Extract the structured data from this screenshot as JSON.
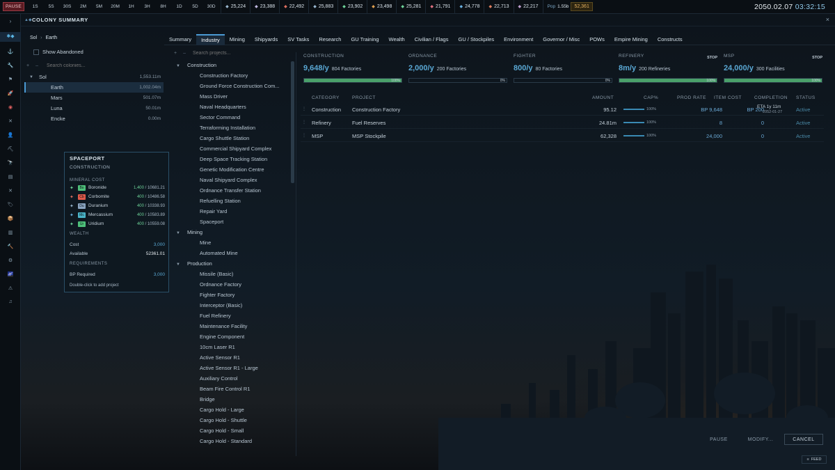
{
  "topbar": {
    "pause_label": "PAUSE",
    "speeds": [
      "1S",
      "5S",
      "30S",
      "2M",
      "5M",
      "20M",
      "1H",
      "3H",
      "8H",
      "1D",
      "5D",
      "30D"
    ],
    "resources": [
      {
        "icon": "duranium-icon",
        "color": "#9ab8d0",
        "value": "25,224"
      },
      {
        "icon": "neutronium-icon",
        "color": "#c0b8e0",
        "value": "23,388"
      },
      {
        "icon": "corbomite-icon",
        "color": "#e07060",
        "value": "22,492"
      },
      {
        "icon": "tritanium-icon",
        "color": "#9ab8d0",
        "value": "25,883"
      },
      {
        "icon": "boronide-icon",
        "color": "#6ed49a",
        "value": "23,902"
      },
      {
        "icon": "mercassium-icon",
        "color": "#e0a050",
        "value": "23,498"
      },
      {
        "icon": "vendarite-icon",
        "color": "#6ed49a",
        "value": "25,281"
      },
      {
        "icon": "sorium-icon",
        "color": "#e07080",
        "value": "21,791"
      },
      {
        "icon": "uridium-icon",
        "color": "#6ab0e0",
        "value": "24,778"
      },
      {
        "icon": "corundium-icon",
        "color": "#e08060",
        "value": "22,713"
      },
      {
        "icon": "gallicite-icon",
        "color": "#c0a0d0",
        "value": "22,217"
      }
    ],
    "pop_label": "Pop",
    "pop_value": "1.55b",
    "wealth": "52,361",
    "date": "2050.02.07",
    "time": "03:32:15"
  },
  "window": {
    "title": "COLONY SUMMARY"
  },
  "breadcrumb": {
    "system": "Sol",
    "colony": "Earth"
  },
  "colonies_panel": {
    "show_abandoned": "Show Abandoned",
    "search_placeholder": "Search colonies...",
    "rows": [
      {
        "name": "Sol",
        "value": "1,553.11m"
      },
      {
        "name": "Earth",
        "value": "1,002.04m"
      },
      {
        "name": "Mars",
        "value": "501.07m"
      },
      {
        "name": "Luna",
        "value": "50.01m"
      },
      {
        "name": "Encke",
        "value": "0.00m"
      }
    ]
  },
  "tooltip": {
    "title": "SPACEPORT",
    "subtitle": "CONSTRUCTION",
    "mineral_header": "MINERAL COST",
    "minerals": [
      {
        "abbr": "Bo",
        "name": "Boronide",
        "need": "1,400",
        "have": "10681.21",
        "color": "#4ec07a",
        "icon": "boronide-icon",
        "ic": "#6ed49a"
      },
      {
        "abbr": "Cb",
        "name": "Corbomite",
        "need": "400",
        "have": "10486.58",
        "color": "#e05a4a",
        "icon": "corbomite-icon",
        "ic": "#e07060"
      },
      {
        "abbr": "Du",
        "name": "Duranium",
        "need": "400",
        "have": "10338.93",
        "color": "#8aa4c0",
        "icon": "duranium-icon",
        "ic": "#9ab8d0"
      },
      {
        "abbr": "Mc",
        "name": "Mercassium",
        "need": "400",
        "have": "10583.89",
        "color": "#4ab4c8",
        "icon": "mercassium-icon",
        "ic": "#6ab0e0"
      },
      {
        "abbr": "Ur",
        "name": "Uridium",
        "need": "400",
        "have": "10559.08",
        "color": "#4ec07a",
        "icon": "uridium-icon",
        "ic": "#6ed49a"
      }
    ],
    "wealth_header": "WEALTH",
    "cost_label": "Cost",
    "cost_value": "3,000",
    "available_label": "Available",
    "available_value": "52361.01",
    "req_header": "REQUIREMENTS",
    "bp_label": "BP Required",
    "bp_value": "3,000",
    "hint": "Double-click to add project"
  },
  "tabs": [
    "Summary",
    "Industry",
    "Mining",
    "Shipyards",
    "SV Tasks",
    "Research",
    "GU Training",
    "Wealth",
    "Civilian / Flags",
    "GU / Stockpiles",
    "Environment",
    "Governor / Misc",
    "POWs",
    "Empire Mining",
    "Constructs"
  ],
  "active_tab": "Industry",
  "projects": {
    "search_placeholder": "Search projects...",
    "categories": [
      {
        "name": "Construction",
        "items": [
          "Construction Factory",
          "Ground Force Construction Com...",
          "Mass Driver",
          "Naval Headquarters",
          "Sector Command",
          "Terraforming Installation",
          "Cargo Shuttle Station",
          "Commercial Shipyard Complex",
          "Deep Space Tracking Station",
          "Genetic Modification Centre",
          "Naval Shipyard Complex",
          "Ordnance Transfer Station",
          "Refuelling Station",
          "Repair Yard",
          "Spaceport"
        ]
      },
      {
        "name": "Mining",
        "items": [
          "Mine",
          "Automated Mine"
        ]
      },
      {
        "name": "Production",
        "items": [
          "Missile (Basic)",
          "Ordnance Factory",
          "Fighter Factory",
          "Interceptor (Basic)",
          "Fuel Refinery",
          "Maintenance Facility",
          "Engine Component",
          "10cm Laser R1",
          "Active Sensor R1",
          "Active Sensor R1 - Large",
          "Auxiliary Control",
          "Beam Fire Control R1",
          "Bridge",
          "Cargo Hold - Large",
          "Cargo Hold - Shuttle",
          "Cargo Hold - Small",
          "Cargo Hold - Standard"
        ]
      }
    ]
  },
  "summary": [
    {
      "label": "CONSTRUCTION",
      "value": "9,648/y",
      "sub": "804 Factories",
      "fill": 1.0,
      "bar": "100%",
      "stop": ""
    },
    {
      "label": "ORDNANCE",
      "value": "2,000/y",
      "sub": "200 Factories",
      "fill": 0,
      "bar": "0%",
      "stop": ""
    },
    {
      "label": "FIGHTER",
      "value": "800/y",
      "sub": "80 Factories",
      "fill": 0,
      "bar": "0%",
      "stop": ""
    },
    {
      "label": "REFINERY",
      "value": "8m/y",
      "sub": "200 Refineries",
      "fill": 1.0,
      "bar": "100%",
      "stop": "STOP"
    },
    {
      "label": "MSP",
      "value": "24,000/y",
      "sub": "300 Facilities",
      "fill": 1.0,
      "bar": "100%",
      "stop": "STOP"
    }
  ],
  "table": {
    "headers": {
      "category": "CATEGORY",
      "project": "PROJECT",
      "amount": "AMOUNT",
      "cap": "CAP%",
      "prod_rate": "PROD RATE",
      "item_cost": "ITEM COST",
      "completion": "COMPLETION",
      "status": "STATUS"
    },
    "rows": [
      {
        "category": "Construction",
        "project": "Construction Factory",
        "amount": "95.12",
        "cap": "100%",
        "prod_rate": "BP 9,648",
        "item_cost": "BP 200",
        "eta": "ETA 1y 11m",
        "eta_date": "2052-01-27",
        "status": "Active"
      },
      {
        "category": "Refinery",
        "project": "Fuel Reserves",
        "amount": "24.81m",
        "cap": "100%",
        "prod_rate": "8",
        "item_cost": "0",
        "eta": "",
        "eta_date": "",
        "status": "Active"
      },
      {
        "category": "MSP",
        "project": "MSP Stockpile",
        "amount": "62,328",
        "cap": "100%",
        "prod_rate": "24,000",
        "item_cost": "0",
        "eta": "",
        "eta_date": "",
        "status": "Active"
      }
    ]
  },
  "buttons": {
    "pause": "PAUSE",
    "modify": "MODIFY...",
    "cancel": "CANCEL"
  },
  "feed_label": "FEED"
}
